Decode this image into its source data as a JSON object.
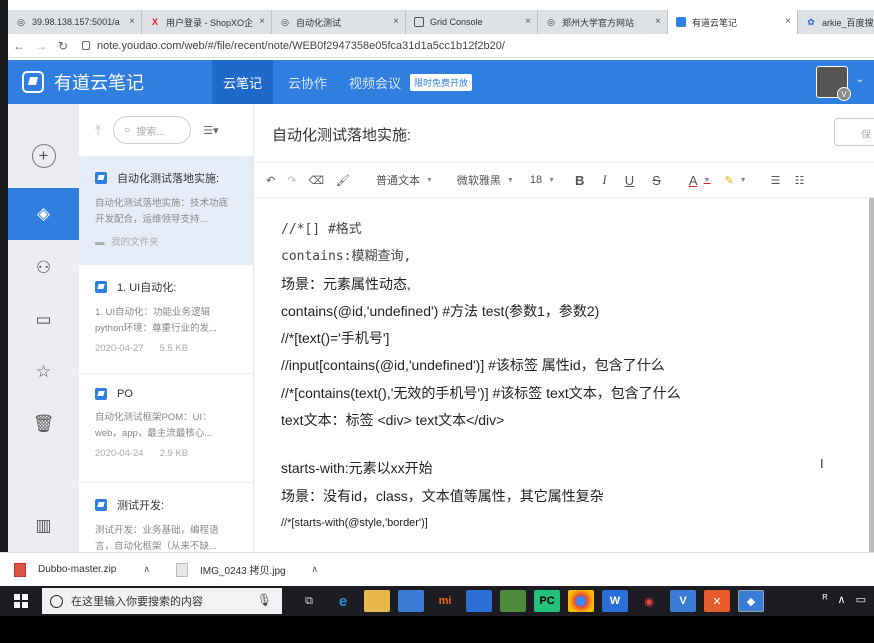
{
  "browser": {
    "tabs": [
      {
        "label": "39.98.138.157:5001/a"
      },
      {
        "label": "用户登录 - ShopXO企"
      },
      {
        "label": "自动化测试"
      },
      {
        "label": "Grid Console"
      },
      {
        "label": "郑州大学官方网站"
      },
      {
        "label": "有道云笔记"
      },
      {
        "label": "arkie_百度搜索"
      }
    ],
    "url": "note.youdao.com/web/#/file/recent/note/WEB0f2947358e05fca31d1a5cc1b12f2b20/"
  },
  "app": {
    "logo": "有道云笔记",
    "nav": {
      "notes": "云笔记",
      "collab": "云协作",
      "meeting": "视频会议",
      "badge": "限时免费开放"
    }
  },
  "list": {
    "search_placeholder": "搜索...",
    "notes": [
      {
        "title": "自动化测试落地实施:",
        "desc": "自动化测试落地实施：技术功底开发配合，运维领导支持...",
        "folder": "我的文件夹"
      },
      {
        "title": "1. UI自动化:",
        "desc": "1. UI自动化：功能业务逻辑python环境：尊重行业的发...",
        "date": "2020-04-27",
        "size": "5.5 KB"
      },
      {
        "title": "PO",
        "desc": "自动化测试框架POM：UI：web，app，最主流最核心...",
        "date": "2020-04-24",
        "size": "2.9 KB"
      },
      {
        "title": "测试开发:",
        "desc": "测试开发：业务基础，编程语言，自动化框架（从来不缺..."
      }
    ]
  },
  "editor": {
    "title": "自动化测试落地实施:",
    "toolbar": {
      "paragraph": "普通文本",
      "font": "微软雅黑",
      "size": "18",
      "bold": "B",
      "italic": "I",
      "underline": "U",
      "strike": "S",
      "color": "A"
    },
    "lines": [
      "//*[]      #格式",
      "contains:模糊查询,",
      "场景：元素属性动态,",
      "contains(@id,'undefined')  #方法  test(参数1，参数2)",
      "//*[text()='手机号']",
      "//input[contains(@id,'undefined')]  #该标签 属性id，包含了什么",
      "//*[contains(text(),'无效的手机号')]  #该标签 text文本，包含了什么",
      "text文本：标签 <div> text文本</div>",
      "starts-with:元素以xx开始",
      "场景：没有id，class，文本值等属性，其它属性复杂",
      "//*[starts-with(@style,'border')]"
    ]
  },
  "downloads": [
    {
      "name": "Dubbo-master.zip"
    },
    {
      "name": "IMG_0243 拷贝.jpg"
    }
  ],
  "taskbar": {
    "search_placeholder": "在这里输入你要搜索的内容"
  }
}
